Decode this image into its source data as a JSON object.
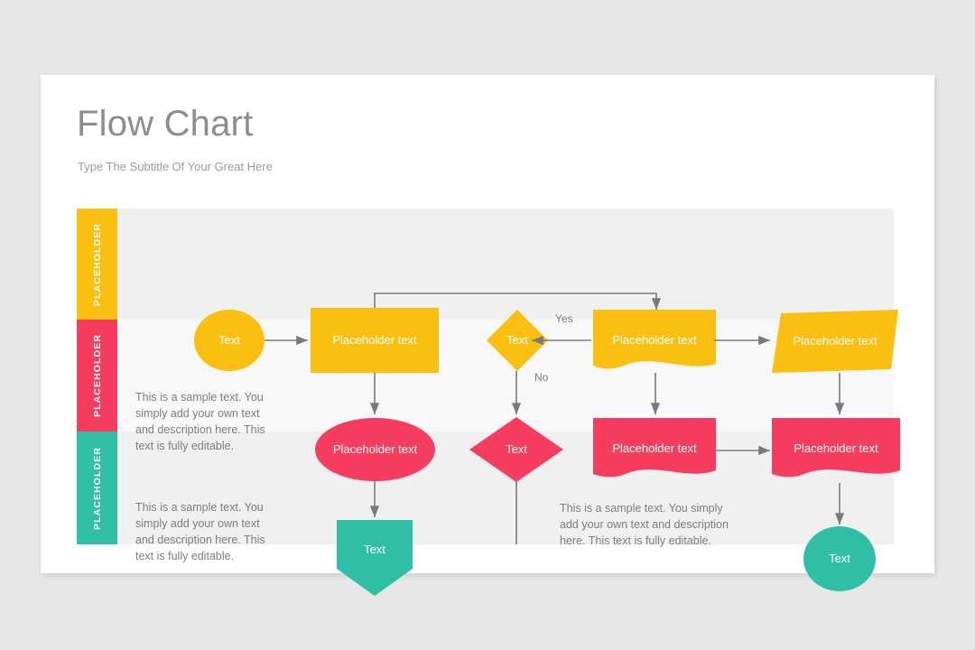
{
  "slide": {
    "title": "Flow Chart",
    "subtitle": "Type The Subtitle Of Your Great Here"
  },
  "colors": {
    "yellow": "#FBBF11",
    "pink": "#F73D5F",
    "teal": "#2FBFA6",
    "band_dark": "#f0f0f0",
    "band_light": "#f8f8f8",
    "connector": "#7a7a7a",
    "text_gray": "#7d7d7d",
    "title_gray": "#8d8d8d",
    "page_bg": "#e7e7e7"
  },
  "bands": [
    {
      "label": "PLACEHOLDER",
      "color": "#FBBF11",
      "bg": "#f0f0f0"
    },
    {
      "label": "PLACEHOLDER",
      "color": "#F73D5F",
      "bg": "#f8f8f8"
    },
    {
      "label": "PLACEHOLDER",
      "color": "#2FBFA6",
      "bg": "#f0f0f0"
    }
  ],
  "row1": {
    "circle_text": "Text",
    "rect_text": "Placeholder text",
    "diamond_text": "Text",
    "doc_text": "Placeholder text",
    "parallelogram_text": "Placeholder text",
    "yes_label": "Yes",
    "no_label": "No"
  },
  "row2": {
    "description": "This is a sample text. You simply add your own text and description here. This text is fully editable.",
    "ellipse_text": "Placeholder text",
    "diamond_text": "Text",
    "doc1_text": "Placeholder text",
    "doc2_text": "Placeholder text"
  },
  "row3": {
    "description_left": "This is a sample text. You simply add your own text and description here. This text is fully editable.",
    "pentagon_text": "Text",
    "description_right": "This is a sample text. You simply add your own text and description here. This text is fully editable.",
    "circle_text": "Text"
  }
}
